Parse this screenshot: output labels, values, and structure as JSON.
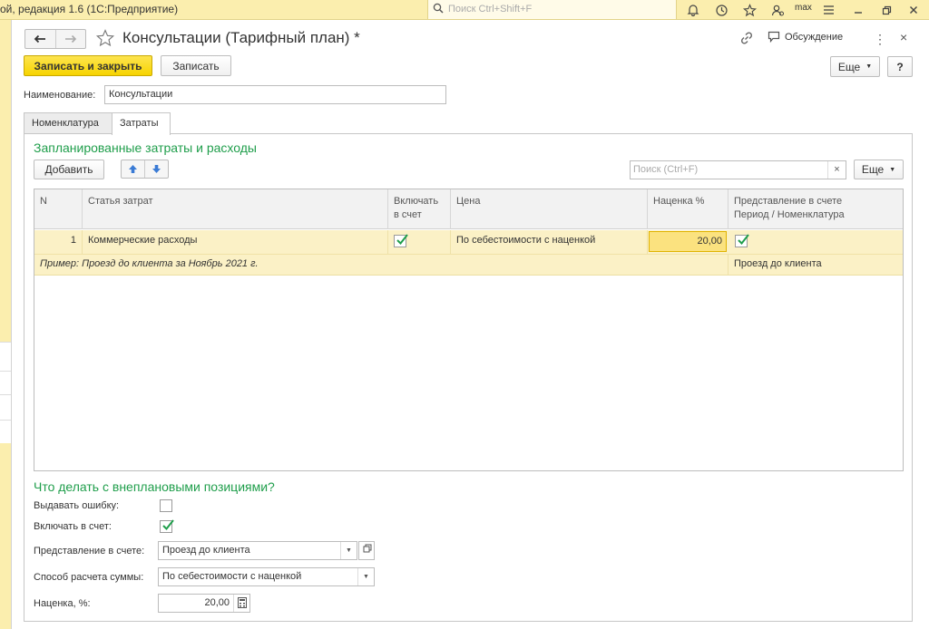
{
  "titlebar": {
    "app_title": "ой, редакция 1.6  (1С:Предприятие)",
    "search_placeholder": "Поиск Ctrl+Shift+F",
    "user": "max"
  },
  "form": {
    "title": "Консультации (Тарифный план) *",
    "discussion": "Обсуждение",
    "save_close": "Записать и закрыть",
    "save": "Записать",
    "more": "Еще",
    "help": "?",
    "name_label": "Наименование:",
    "name_value": "Консультации"
  },
  "tabs": [
    {
      "label": "Номенклатура",
      "active": false
    },
    {
      "label": "Затраты",
      "active": true
    }
  ],
  "costs": {
    "section_title": "Запланированные затраты и расходы",
    "add_button": "Добавить",
    "search_placeholder": "Поиск (Ctrl+F)",
    "search_clear": "×",
    "more": "Еще",
    "columns": {
      "n": "N",
      "item": "Статья затрат",
      "include_1": "Включать",
      "include_2": "в счет",
      "price": "Цена",
      "markup": "Наценка %",
      "repr_1": "Представление в счете",
      "repr_2": "Период / Номенклатура"
    },
    "rows": [
      {
        "n": "1",
        "item": "Коммерческие расходы",
        "include": true,
        "price": "По себестоимости с наценкой",
        "markup": "20,00",
        "repr_checked": true,
        "example": "Пример: Проезд до клиента за Ноябрь 2021 г.",
        "repr_text": "Проезд до клиента"
      }
    ]
  },
  "unplanned": {
    "section_title": "Что делать с внеплановыми позициями?",
    "error_label": "Выдавать ошибку:",
    "error_checked": false,
    "include_label": "Включать в счет:",
    "include_checked": true,
    "repr_label": "Представление в счете:",
    "repr_value": "Проезд до клиента",
    "calc_label": "Способ расчета суммы:",
    "calc_value": "По себестоимости с наценкой",
    "markup_label": "Наценка, %:",
    "markup_value": "20,00"
  },
  "colors": {
    "accent_yellow": "#f7d400",
    "section_green": "#1f9e4b",
    "row_highlight": "#fbf1c6",
    "titlebar": "#fbeeae"
  }
}
